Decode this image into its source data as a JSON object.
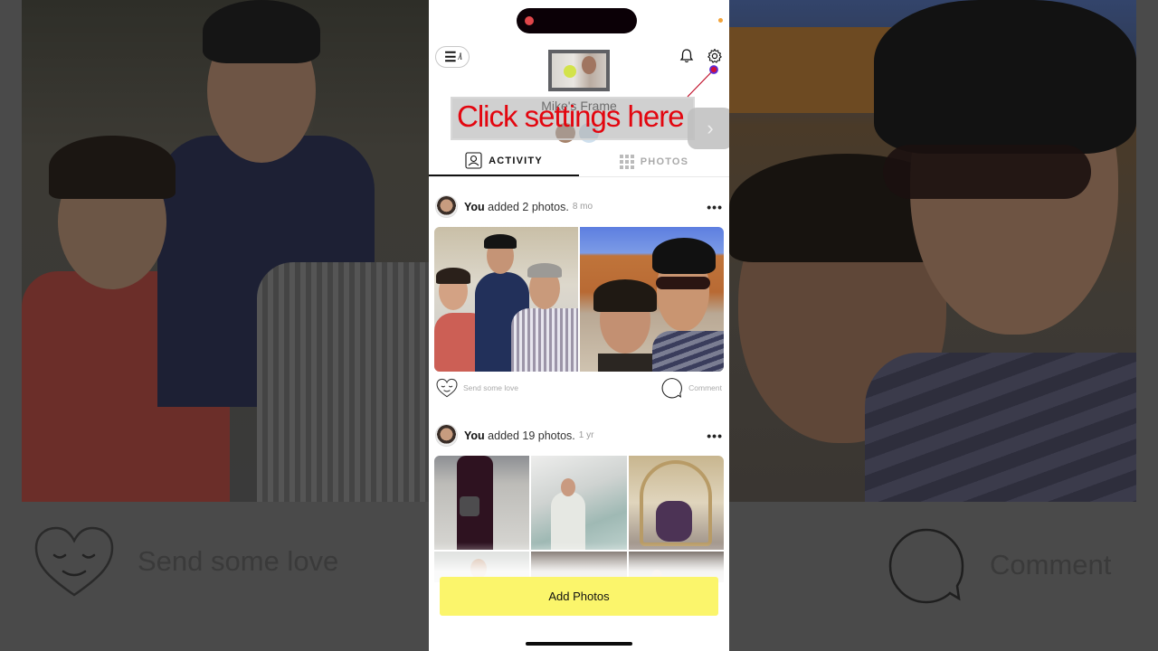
{
  "app": {
    "frame_name": "Mike's Frame",
    "tutorial_hint": "Click settings here",
    "next_chip": "›"
  },
  "header": {
    "menu_icon": "hamburger-icon",
    "notifications_icon": "bell-icon",
    "settings_icon": "gear-icon"
  },
  "tabs": [
    {
      "label": "ACTIVITY",
      "icon": "person-icon",
      "active": true
    },
    {
      "label": "PHOTOS",
      "icon": "grid-icon",
      "active": false
    }
  ],
  "feed": [
    {
      "user": "You",
      "action": "added 2 photos.",
      "time": "8 mo",
      "more": "•••",
      "photo_count_shown": 2,
      "love_label": "Send some love",
      "comment_label": "Comment"
    },
    {
      "user": "You",
      "action": "added 19 photos.",
      "time": "1 yr",
      "more": "•••",
      "photo_count_shown": 6
    }
  ],
  "footer": {
    "add_photos_label": "Add Photos"
  },
  "background_zoom": {
    "love_label": "Send some love",
    "comment_label": "Comment"
  },
  "colors": {
    "hint_text": "#e3060f",
    "add_button": "#fbf56b",
    "record_dot": "#e0464a",
    "status_dot": "#f2a33a",
    "pointer_dot": "#5a2bd8"
  }
}
